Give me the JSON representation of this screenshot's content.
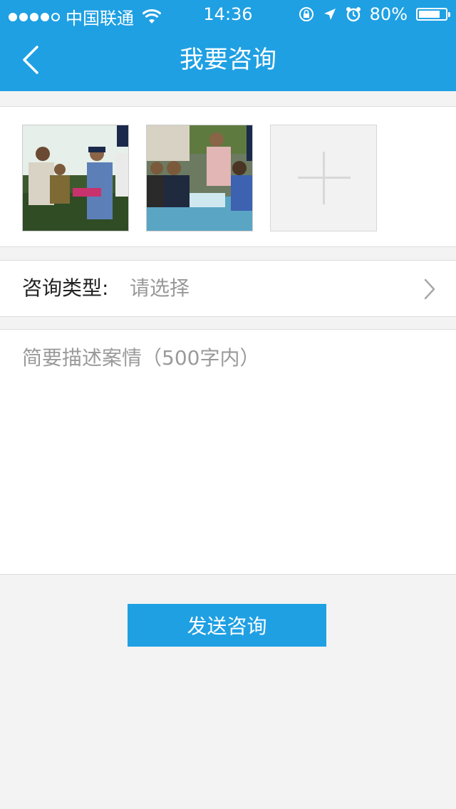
{
  "status_bar": {
    "carrier": "中国联通",
    "time": "14:36",
    "battery_percent": "80%",
    "battery_level": 0.8,
    "signal_bars_filled": 4,
    "signal_bars_total": 5
  },
  "nav": {
    "title": "我要咨询",
    "back_icon": "chevron-left-icon"
  },
  "photos": {
    "items": [
      {
        "name": "consult-photo-1",
        "description_icon": "photo-thumbnail"
      },
      {
        "name": "consult-photo-2",
        "description_icon": "photo-thumbnail"
      }
    ],
    "add_icon": "plus-icon"
  },
  "consult_type": {
    "label": "咨询类型:",
    "placeholder": "请选择",
    "arrow_icon": "chevron-right-icon"
  },
  "description": {
    "placeholder": "简要描述案情（500字内）",
    "value": ""
  },
  "submit": {
    "label": "发送咨询"
  },
  "colors": {
    "primary": "#1fa0e3",
    "background": "#f3f3f3",
    "placeholder": "#999999"
  }
}
